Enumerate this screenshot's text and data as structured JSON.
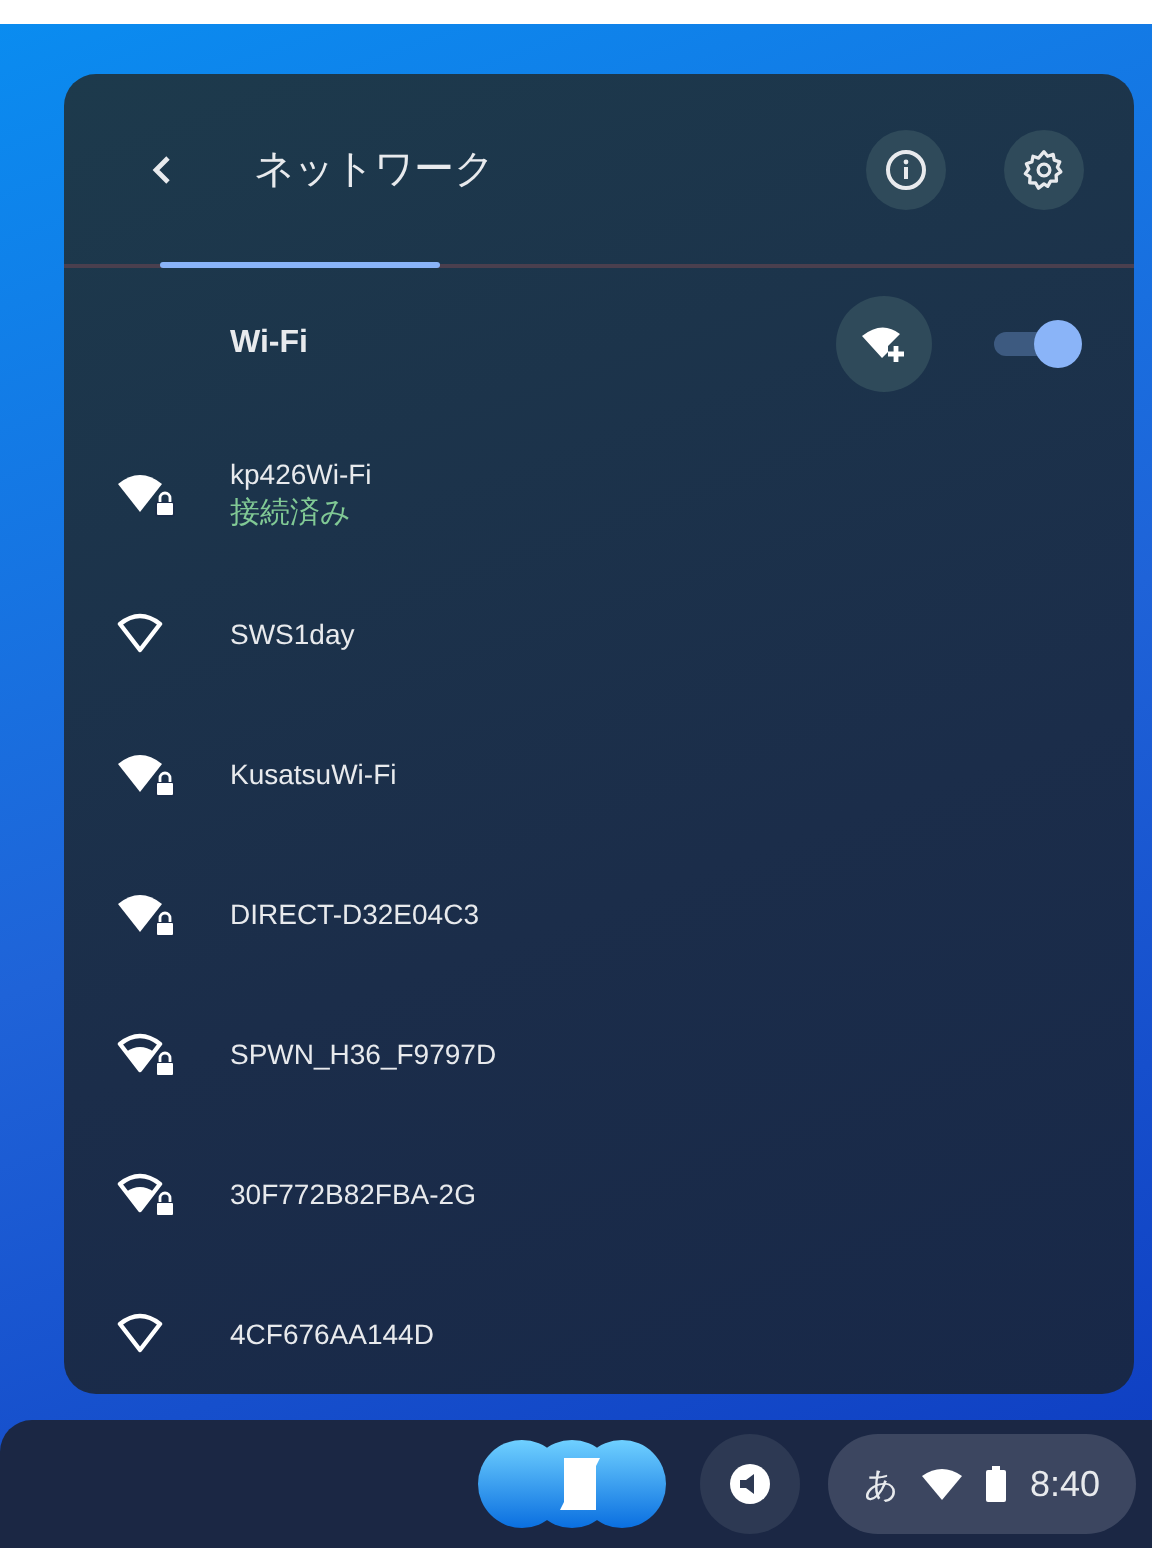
{
  "panel": {
    "title": "ネットワーク",
    "tab_underline": true
  },
  "wifi": {
    "label": "Wi-Fi",
    "on": true
  },
  "networks": [
    {
      "name": "kp426Wi-Fi",
      "status": "接続済み",
      "kind": "full",
      "secured": true
    },
    {
      "name": "SWS1day",
      "kind": "empty",
      "secured": false
    },
    {
      "name": "KusatsuWi-Fi",
      "kind": "full",
      "secured": true
    },
    {
      "name": "DIRECT-D32E04C3",
      "kind": "full",
      "secured": true
    },
    {
      "name": "SPWN_H36_F9797D",
      "kind": "medium",
      "secured": true
    },
    {
      "name": "30F772B82FBA-2G",
      "kind": "medium",
      "secured": true
    },
    {
      "name": "4CF676AA144D",
      "kind": "empty",
      "secured": false
    }
  ],
  "shelf": {
    "ime": "あ",
    "time": "8:40"
  }
}
